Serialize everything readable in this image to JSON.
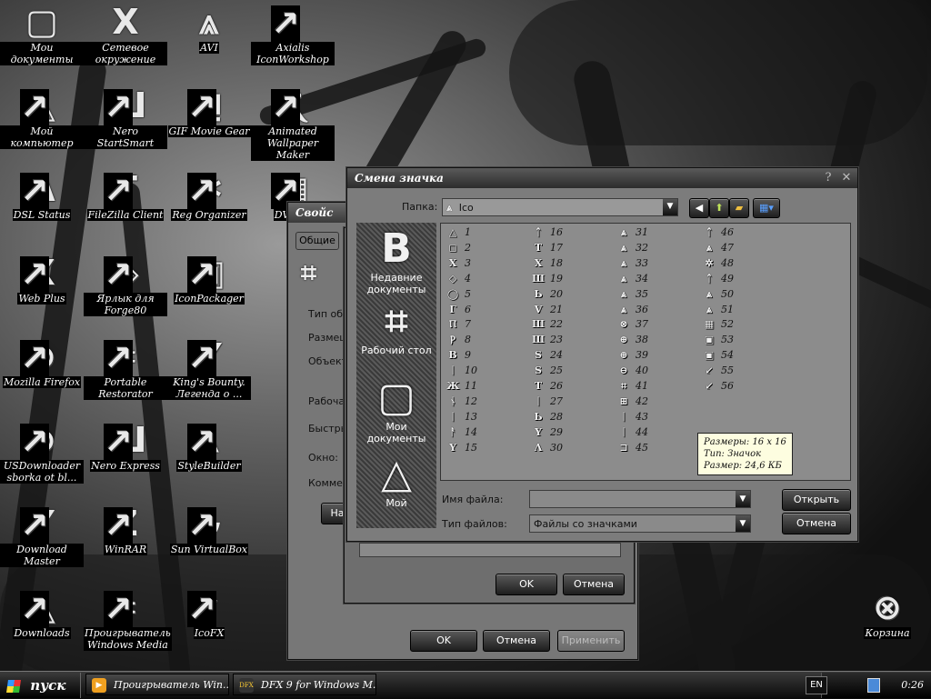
{
  "desktop_icons": [
    {
      "label": "Мои документы",
      "glyph": "▢",
      "col": 0,
      "row": 0
    },
    {
      "label": "Сетевое окружение",
      "glyph": "X",
      "col": 1,
      "row": 0
    },
    {
      "label": "AVI",
      "glyph": "⩓",
      "col": 2,
      "row": 0
    },
    {
      "label": "Axialis IconWorkshop",
      "glyph": "I",
      "col": 3,
      "row": 0
    },
    {
      "label": "Мой компьютер",
      "glyph": "△",
      "col": 0,
      "row": 1
    },
    {
      "label": "Nero StartSmart",
      "glyph": "Ш",
      "col": 1,
      "row": 1
    },
    {
      "label": "GIF Movie Gear",
      "glyph": "⊒",
      "col": 2,
      "row": 1
    },
    {
      "label": "Animated Wallpaper Maker",
      "glyph": "Ⲭ",
      "col": 3,
      "row": 1
    },
    {
      "label": "DSL Status",
      "glyph": "Λ",
      "col": 0,
      "row": 2
    },
    {
      "label": "FileZilla Client",
      "glyph": "T",
      "col": 1,
      "row": 2
    },
    {
      "label": "Reg Organizer",
      "glyph": "✲",
      "col": 2,
      "row": 2
    },
    {
      "label": "DVDCo",
      "glyph": "▦",
      "col": 3,
      "row": 2
    },
    {
      "label": "Web Plus",
      "glyph": "X",
      "col": 0,
      "row": 3
    },
    {
      "label": "Ярлык для Forge80",
      "glyph": "◈",
      "col": 1,
      "row": 3
    },
    {
      "label": "IconPackager",
      "glyph": "▣",
      "col": 2,
      "row": 3
    },
    {
      "label": "Mozilla Firefox",
      "glyph": "⊕",
      "col": 0,
      "row": 4
    },
    {
      "label": "Portable Restorator",
      "glyph": "⌗",
      "col": 1,
      "row": 4
    },
    {
      "label": "King's Bounty. Легенда о ...",
      "glyph": "Y",
      "col": 2,
      "row": 4
    },
    {
      "label": "USDownloader sborka ot bl...",
      "glyph": "⊗",
      "col": 0,
      "row": 5
    },
    {
      "label": "Nero Express",
      "glyph": "Ш",
      "col": 1,
      "row": 5
    },
    {
      "label": "StyleBuilder",
      "glyph": "⩓",
      "col": 2,
      "row": 5
    },
    {
      "label": "Download Master",
      "glyph": "Y",
      "col": 0,
      "row": 6
    },
    {
      "label": "WinRAR",
      "glyph": "Z",
      "col": 1,
      "row": 6
    },
    {
      "label": "Sun VirtualBox",
      "glyph": "∿",
      "col": 2,
      "row": 6
    },
    {
      "label": "Downloads",
      "glyph": "△",
      "col": 0,
      "row": 7
    },
    {
      "label": "Проигрыватель Windows Media",
      "glyph": "⌗",
      "col": 1,
      "row": 7
    },
    {
      "label": "IcoFX",
      "glyph": "↑",
      "col": 2,
      "row": 7
    }
  ],
  "recycle_bin": {
    "label": "Корзина",
    "glyph": "⊗"
  },
  "props_window": {
    "title": "Свойс",
    "tab_general": "Общие",
    "rows": [
      "Тип объ",
      "Размещ",
      "Объект",
      "Рабочая",
      "Быстры",
      "Окно:",
      "Коммен"
    ],
    "btn_partial": "На",
    "ok": "OK",
    "cancel": "Отмена",
    "apply": "Применить"
  },
  "change_icon_window": {
    "title": "Смена значка",
    "ok": "OK",
    "cancel": "Отмена"
  },
  "open_dialog": {
    "folder_label": "Папка:",
    "folder_value": "Ico",
    "filename_label": "Имя файла:",
    "filename_value": "",
    "filetype_label": "Тип файлов:",
    "filetype_value": "Файлы со значками",
    "open": "Открыть",
    "cancel": "Отмена",
    "places": [
      {
        "label": "Недавние документы",
        "glyph": "B"
      },
      {
        "label": "Рабочий стол",
        "glyph": "⌗"
      },
      {
        "label": "Мои документы",
        "glyph": "▢"
      },
      {
        "label": "Мой",
        "glyph": "△"
      }
    ],
    "files": [
      {
        "n": "1",
        "g": "△"
      },
      {
        "n": "2",
        "g": "◻"
      },
      {
        "n": "3",
        "g": "X"
      },
      {
        "n": "4",
        "g": "◇"
      },
      {
        "n": "5",
        "g": "◯"
      },
      {
        "n": "6",
        "g": "Г"
      },
      {
        "n": "7",
        "g": "Ⲡ"
      },
      {
        "n": "8",
        "g": "Ⲣ"
      },
      {
        "n": "9",
        "g": "B"
      },
      {
        "n": "10",
        "g": "ᛁ"
      },
      {
        "n": "11",
        "g": "Ж"
      },
      {
        "n": "12",
        "g": "ᚾ"
      },
      {
        "n": "13",
        "g": "ᛁ"
      },
      {
        "n": "14",
        "g": "ᚨ"
      },
      {
        "n": "15",
        "g": "Y"
      },
      {
        "n": "16",
        "g": "ᛏ"
      },
      {
        "n": "17",
        "g": "T"
      },
      {
        "n": "18",
        "g": "X"
      },
      {
        "n": "19",
        "g": "Ш"
      },
      {
        "n": "20",
        "g": "Ь"
      },
      {
        "n": "21",
        "g": "V"
      },
      {
        "n": "22",
        "g": "Ш"
      },
      {
        "n": "23",
        "g": "Ш"
      },
      {
        "n": "24",
        "g": "S"
      },
      {
        "n": "25",
        "g": "S"
      },
      {
        "n": "26",
        "g": "T"
      },
      {
        "n": "27",
        "g": "ᛁ"
      },
      {
        "n": "28",
        "g": "Ь"
      },
      {
        "n": "29",
        "g": "Y"
      },
      {
        "n": "30",
        "g": "Λ"
      },
      {
        "n": "31",
        "g": "⩓"
      },
      {
        "n": "32",
        "g": "⩓"
      },
      {
        "n": "33",
        "g": "⩓"
      },
      {
        "n": "34",
        "g": "⩓"
      },
      {
        "n": "35",
        "g": "⩓"
      },
      {
        "n": "36",
        "g": "⩓"
      },
      {
        "n": "37",
        "g": "⊗"
      },
      {
        "n": "38",
        "g": "⊕"
      },
      {
        "n": "39",
        "g": "⊕"
      },
      {
        "n": "40",
        "g": "⊖"
      },
      {
        "n": "41",
        "g": "⌗"
      },
      {
        "n": "42",
        "g": "⊞"
      },
      {
        "n": "43",
        "g": "ᛁ"
      },
      {
        "n": "44",
        "g": "ᛁ"
      },
      {
        "n": "45",
        "g": "⊐"
      },
      {
        "n": "46",
        "g": "ᛏ"
      },
      {
        "n": "47",
        "g": "⩓"
      },
      {
        "n": "48",
        "g": "✲"
      },
      {
        "n": "49",
        "g": "ᛏ"
      },
      {
        "n": "50",
        "g": "⩓"
      },
      {
        "n": "51",
        "g": "⩓"
      },
      {
        "n": "52",
        "g": "▦"
      },
      {
        "n": "53",
        "g": "▣"
      },
      {
        "n": "54",
        "g": "▣"
      },
      {
        "n": "55",
        "g": "↙"
      },
      {
        "n": "56",
        "g": "↙"
      }
    ],
    "tooltip": {
      "size": "Размеры: 16 x 16",
      "type": "Тип: Значок",
      "filesize": "Размер: 24,6 КБ"
    }
  },
  "taskbar": {
    "start": "пуск",
    "tasks": [
      {
        "label": "Проигрыватель Win...",
        "icon": "▶"
      },
      {
        "label": "DFX 9 for Windows M...",
        "icon": "DFX"
      }
    ],
    "lang": "EN",
    "clock": "0:26"
  }
}
